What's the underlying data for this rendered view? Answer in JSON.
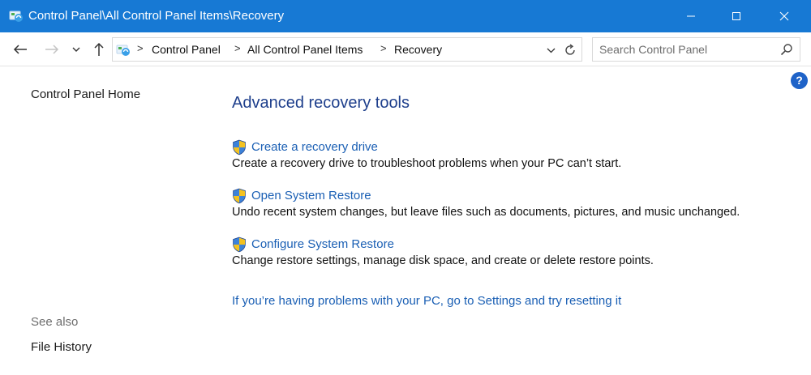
{
  "window": {
    "title": "Control Panel\\All Control Panel Items\\Recovery"
  },
  "address": {
    "crumbs": [
      "Control Panel",
      "All Control Panel Items",
      "Recovery"
    ]
  },
  "search": {
    "placeholder": "Search Control Panel"
  },
  "help": {
    "label": "?"
  },
  "sidebar": {
    "home_label": "Control Panel Home",
    "see_also_label": "See also",
    "items": [
      {
        "label": "File History"
      }
    ]
  },
  "main": {
    "heading": "Advanced recovery tools",
    "tools": [
      {
        "link": "Create a recovery drive",
        "description": "Create a recovery drive to troubleshoot problems when your PC can’t start."
      },
      {
        "link": "Open System Restore",
        "description": "Undo recent system changes, but leave files such as documents, pictures, and music unchanged."
      },
      {
        "link": "Configure System Restore",
        "description": "Change restore settings, manage disk space, and create or delete restore points."
      }
    ],
    "reset_link": "If you’re having problems with your PC, go to Settings and try resetting it"
  },
  "colors": {
    "titlebar": "#1779d4",
    "heading": "#1e3f8c",
    "link": "#1a5fb4",
    "help": "#1e63c8"
  },
  "icons": {
    "title": "control-panel-icon",
    "shield": "uac-shield-icon",
    "search": "search-icon",
    "refresh": "refresh-icon"
  }
}
